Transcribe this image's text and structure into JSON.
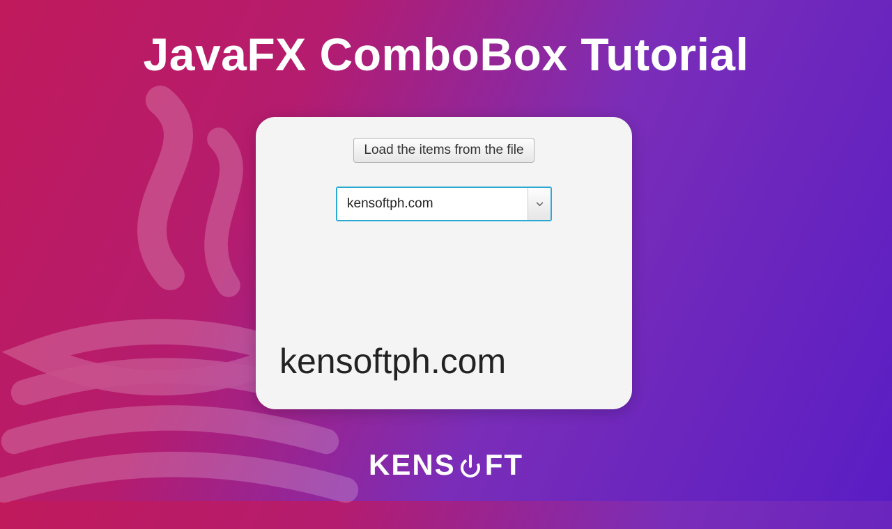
{
  "title": "JavaFX ComboBox Tutorial",
  "panel": {
    "load_button_label": "Load the items from the file",
    "combobox": {
      "value": "kensoftph.com"
    },
    "output_label": "kensoftph.com"
  },
  "brand": {
    "prefix": "KENS",
    "suffix": "FT"
  }
}
